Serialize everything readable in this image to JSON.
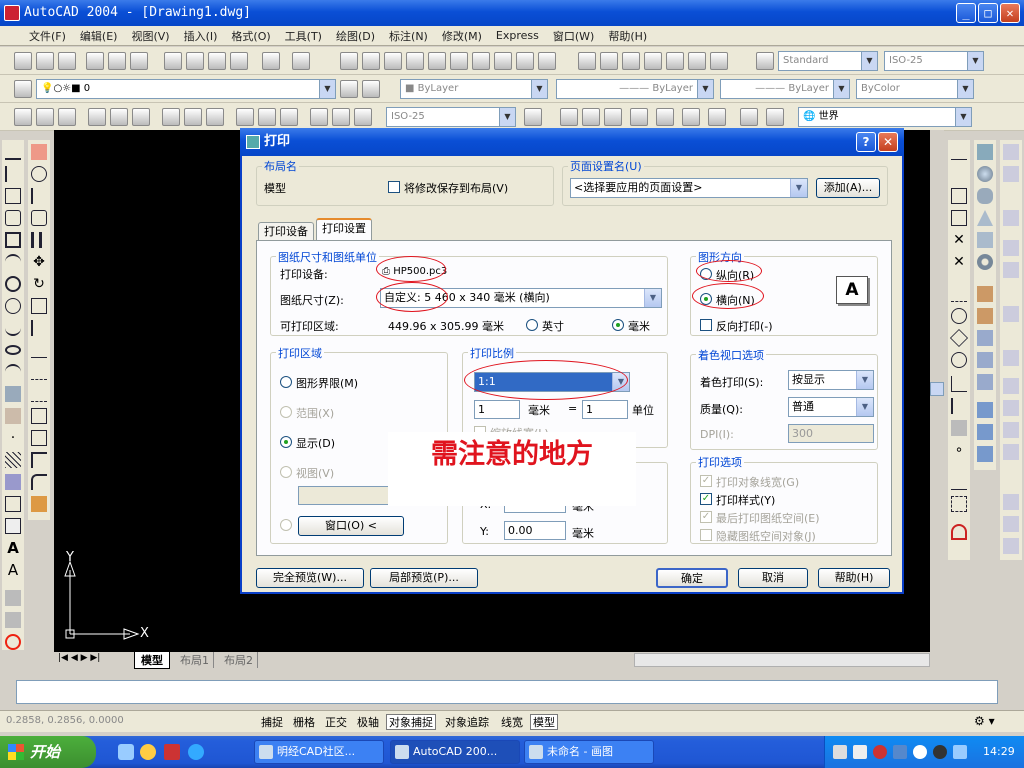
{
  "window": {
    "title": "AutoCAD 2004 - [Drawing1.dwg]"
  },
  "menu": [
    "文件(F)",
    "编辑(E)",
    "视图(V)",
    "插入(I)",
    "格式(O)",
    "工具(T)",
    "绘图(D)",
    "标注(N)",
    "修改(M)",
    "Express",
    "窗口(W)",
    "帮助(H)"
  ],
  "toolbar": {
    "text_style": "Standard",
    "dim_style": "ISO-25",
    "layer_value": "0",
    "color": "ByLayer",
    "linetype": "ByLayer",
    "lineweight": "ByLayer",
    "plotstyle": "ByColor",
    "dim_style2": "ISO-25",
    "ucs": "世界"
  },
  "dialog": {
    "title": "打印",
    "help_btn": "?",
    "close_btn": "✕",
    "layout_group": "布局名",
    "layout_name": "模型",
    "save_changes": "将修改保存到布局(V)",
    "page_setup_group": "页面设置名(U)",
    "page_setup_value": "<选择要应用的页面设置>",
    "add_btn": "添加(A)...",
    "tabs": [
      "打印设备",
      "打印设置"
    ],
    "paper_group": "图纸尺寸和图纸单位",
    "device_label": "打印设备:",
    "device_value": "HP500.pc3",
    "paper_size_label": "图纸尺寸(Z):",
    "paper_size_value": "自定义: 5 460 x 340 毫米 (横向)",
    "printable_label": "可打印区域:",
    "printable_value": "449.96 x 305.99 毫米",
    "unit_inch": "英寸",
    "unit_mm": "毫米",
    "orient_group": "图形方向",
    "portrait": "纵向(R)",
    "landscape": "横向(N)",
    "reverse": "反向打印(-)",
    "orient_icon_letter": "A",
    "area_group": "打印区域",
    "limits": "图形界限(M)",
    "extents": "范围(X)",
    "display": "显示(D)",
    "view": "视图(V)",
    "window_btn": "窗口(O) <",
    "scale_group": "打印比例",
    "scale_value": "1:1",
    "scale_mm": "1",
    "scale_mm_label": "毫米",
    "scale_eq": "=",
    "scale_unit": "1",
    "scale_unit_label": "单位",
    "scale_lineweight": "缩放线宽(L)",
    "offset_x_label": "X:",
    "offset_x_unit": "毫米",
    "offset_y_label": "Y:",
    "offset_y_value": "0.00",
    "offset_y_unit": "毫米",
    "shade_group": "着色视口选项",
    "shade_plot_label": "着色打印(S):",
    "shade_plot_value": "按显示",
    "quality_label": "质量(Q):",
    "quality_value": "普通",
    "dpi_label": "DPI(I):",
    "dpi_value": "300",
    "options_group": "打印选项",
    "opt_lineweights": "打印对象线宽(G)",
    "opt_plotstyles": "打印样式(Y)",
    "opt_paperspace": "最后打印图纸空间(E)",
    "opt_hide": "隐藏图纸空间对象(J)",
    "full_preview": "完全预览(W)...",
    "partial_preview": "局部预览(P)...",
    "ok": "确定",
    "cancel": "取消",
    "help": "帮助(H)"
  },
  "annotation": "需注意的地方",
  "ucs_labels": {
    "y": "Y",
    "x": "X"
  },
  "layout_tabs": [
    "模型",
    "布局1",
    "布局2"
  ],
  "status": {
    "coords": "0.2858, 0.2856, 0.0000",
    "buttons": [
      "捕捉",
      "栅格",
      "正交",
      "极轴",
      "对象捕捉",
      "对象追踪",
      "线宽",
      "模型"
    ]
  },
  "taskbar": {
    "start": "开始",
    "tasks": [
      "明经CAD社区...",
      "AutoCAD 200...",
      "未命名 - 画图"
    ],
    "clock": "14:29"
  }
}
